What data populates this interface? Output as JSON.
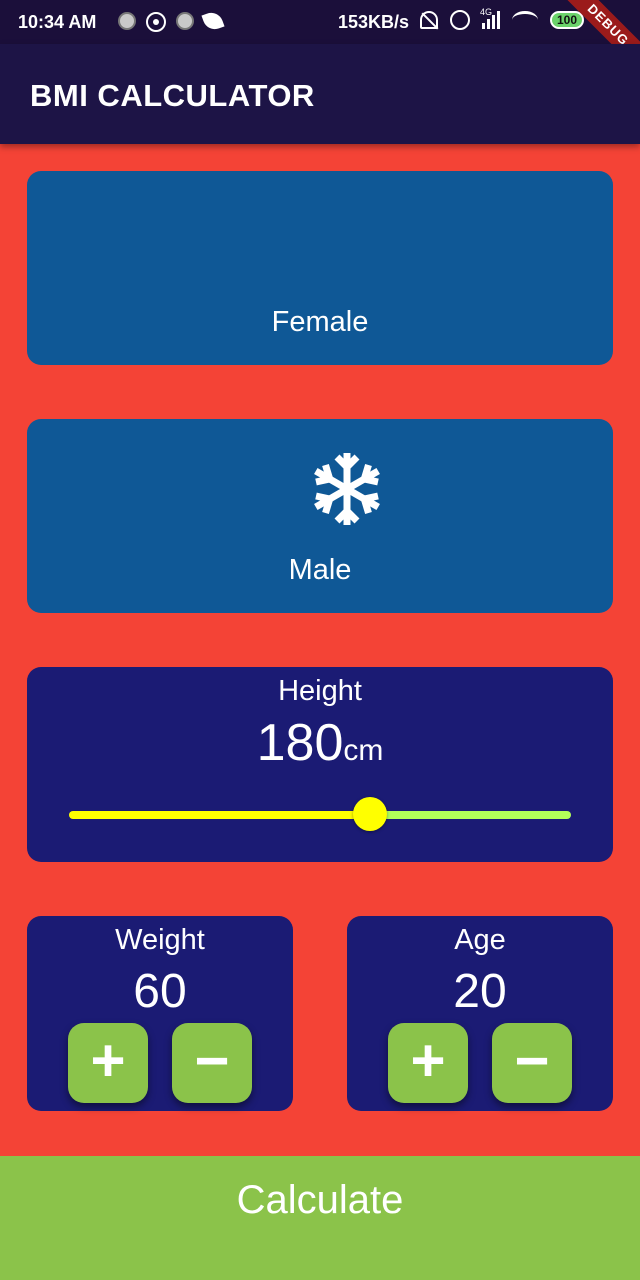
{
  "status_bar": {
    "time": "10:34 AM",
    "speed": "153KB/s",
    "network": "4G",
    "battery": "100",
    "debug_banner": "DEBUG"
  },
  "app_bar": {
    "title": "BMI CALCULATOR"
  },
  "gender": {
    "female_label": "Female",
    "male_label": "Male",
    "male_icon": "snowflake-icon"
  },
  "height": {
    "label": "Height",
    "value": "180",
    "unit": "cm",
    "slider_fraction": 0.6
  },
  "weight": {
    "label": "Weight",
    "value": "60",
    "plus": "+",
    "minus": "−"
  },
  "age": {
    "label": "Age",
    "value": "20",
    "plus": "+",
    "minus": "−"
  },
  "calculate_label": "Calculate",
  "colors": {
    "background": "#f44336",
    "app_bar": "#1d1446",
    "gender_card": "#0f5896",
    "dark_card": "#1b1b74",
    "accent_green": "#8bc34a",
    "slider_active": "#ffff00",
    "slider_inactive": "#b2ff59"
  }
}
